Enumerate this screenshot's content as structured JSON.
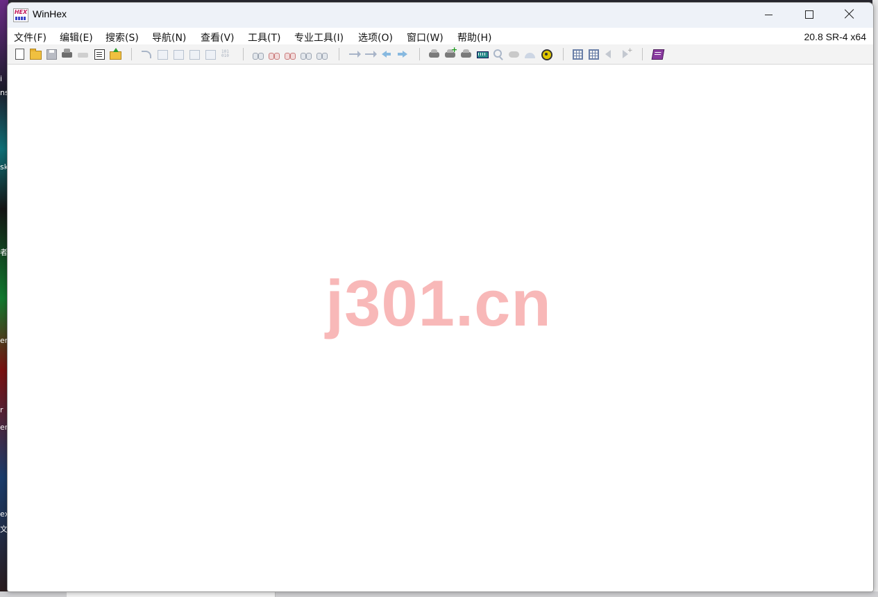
{
  "window": {
    "title": "WinHex",
    "version": "20.8 SR-4 x64"
  },
  "menu": [
    "文件(F)",
    "编辑(E)",
    "搜索(S)",
    "导航(N)",
    "查看(V)",
    "工具(T)",
    "专业工具(I)",
    "选项(O)",
    "窗口(W)",
    "帮助(H)"
  ],
  "app_icon_text": "HEX",
  "watermark": "j301.cn",
  "desktop_labels": [
    "i",
    "ns",
    "sk",
    "者",
    "er",
    "r",
    "er",
    "ex",
    "文"
  ],
  "toolbar_icons": [
    "new-file-icon",
    "open-folder-icon",
    "save-icon",
    "open-disk-icon",
    "disk-gray-icon",
    "properties-icon",
    "up-folder-icon",
    "undo-icon",
    "copy-icon",
    "cut-icon",
    "paste-icon",
    "paste-special-icon",
    "binary-icon",
    "find-text-icon",
    "find-hex-icon",
    "replace-text-icon",
    "replace-hex-icon",
    "find-fuzzy-icon",
    "goto-offset-icon",
    "goto-sector-icon",
    "back-icon",
    "forward-icon",
    "open-drive-icon",
    "add-drive-icon",
    "clone-disk-icon",
    "ram-icon",
    "magnify-icon",
    "cloud-icon",
    "wave-icon",
    "gear-icon",
    "data-interpreter-icon",
    "grid-icon",
    "prev-icon",
    "next-icon",
    "help-book-icon"
  ],
  "colors": {
    "titlebar": "#eef2f8",
    "watermark": "#f8b8b8"
  }
}
